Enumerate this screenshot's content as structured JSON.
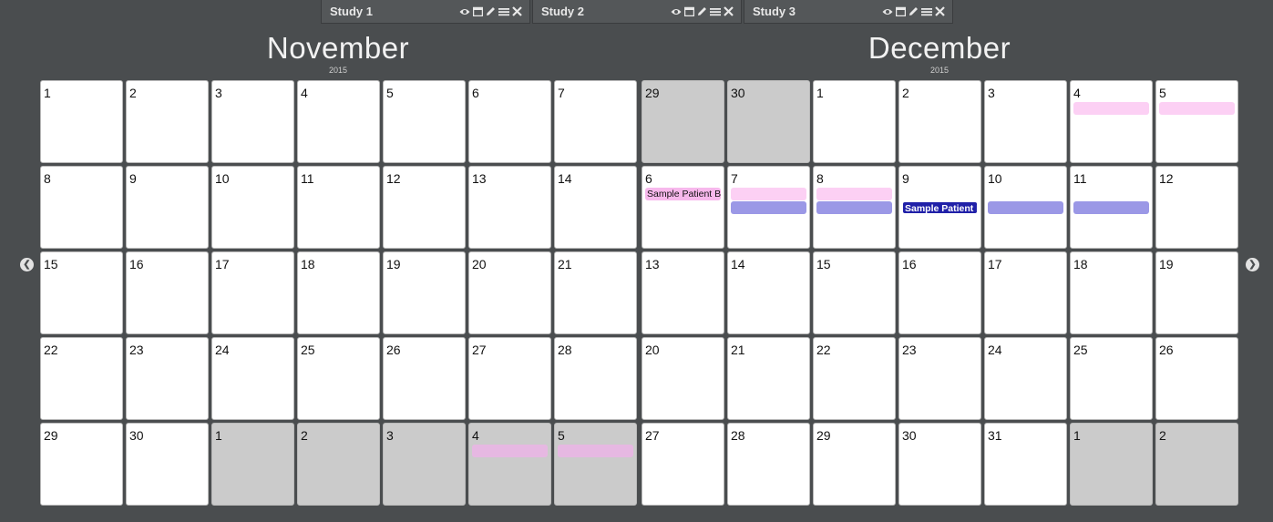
{
  "studies": [
    {
      "label": "Study 1"
    },
    {
      "label": "Study 2"
    },
    {
      "label": "Study 3"
    }
  ],
  "tab_icons": [
    "eye-icon",
    "calendar-icon",
    "pencil-icon",
    "menu-icon",
    "close-icon"
  ],
  "navigation": {
    "prev_icon": "chevron-left-icon",
    "next_icon": "chevron-right-icon"
  },
  "months": [
    {
      "name": "November",
      "year": "2015",
      "days": [
        {
          "n": "1",
          "other": false
        },
        {
          "n": "2",
          "other": false
        },
        {
          "n": "3",
          "other": false
        },
        {
          "n": "4",
          "other": false
        },
        {
          "n": "5",
          "other": false
        },
        {
          "n": "6",
          "other": false
        },
        {
          "n": "7",
          "other": false
        },
        {
          "n": "8",
          "other": false
        },
        {
          "n": "9",
          "other": false
        },
        {
          "n": "10",
          "other": false
        },
        {
          "n": "11",
          "other": false
        },
        {
          "n": "12",
          "other": false
        },
        {
          "n": "13",
          "other": false
        },
        {
          "n": "14",
          "other": false
        },
        {
          "n": "15",
          "other": false
        },
        {
          "n": "16",
          "other": false
        },
        {
          "n": "17",
          "other": false
        },
        {
          "n": "18",
          "other": false
        },
        {
          "n": "19",
          "other": false
        },
        {
          "n": "20",
          "other": false
        },
        {
          "n": "21",
          "other": false
        },
        {
          "n": "22",
          "other": false
        },
        {
          "n": "23",
          "other": false
        },
        {
          "n": "24",
          "other": false
        },
        {
          "n": "25",
          "other": false
        },
        {
          "n": "26",
          "other": false
        },
        {
          "n": "27",
          "other": false
        },
        {
          "n": "28",
          "other": false
        },
        {
          "n": "29",
          "other": false
        },
        {
          "n": "30",
          "other": false
        },
        {
          "n": "1",
          "other": true
        },
        {
          "n": "2",
          "other": true
        },
        {
          "n": "3",
          "other": true
        },
        {
          "n": "4",
          "other": true,
          "events": [
            {
              "style": "mauve",
              "label": ""
            }
          ]
        },
        {
          "n": "5",
          "other": true,
          "events": [
            {
              "style": "mauve",
              "label": ""
            }
          ]
        }
      ]
    },
    {
      "name": "December",
      "year": "2015",
      "days": [
        {
          "n": "29",
          "other": true
        },
        {
          "n": "30",
          "other": true
        },
        {
          "n": "1",
          "other": false
        },
        {
          "n": "2",
          "other": false
        },
        {
          "n": "3",
          "other": false
        },
        {
          "n": "4",
          "other": false,
          "events": [
            {
              "style": "light",
              "label": ""
            }
          ]
        },
        {
          "n": "5",
          "other": false,
          "events": [
            {
              "style": "light",
              "label": ""
            }
          ]
        },
        {
          "n": "6",
          "other": false,
          "events": [
            {
              "style": "pink",
              "label": "Sample Patient B"
            }
          ]
        },
        {
          "n": "7",
          "other": false,
          "events": [
            {
              "style": "light",
              "label": ""
            },
            {
              "style": "purple",
              "label": ""
            }
          ]
        },
        {
          "n": "8",
          "other": false,
          "events": [
            {
              "style": "light",
              "label": ""
            },
            {
              "style": "purple",
              "label": ""
            }
          ]
        },
        {
          "n": "9",
          "other": false,
          "events": [
            {
              "style": "dark",
              "label": "Sample Patient F",
              "slot": 1
            }
          ]
        },
        {
          "n": "10",
          "other": false,
          "events": [
            {
              "style": "purple",
              "label": "",
              "slot": 1
            }
          ]
        },
        {
          "n": "11",
          "other": false,
          "events": [
            {
              "style": "purple",
              "label": "",
              "slot": 1
            }
          ]
        },
        {
          "n": "12",
          "other": false
        },
        {
          "n": "13",
          "other": false
        },
        {
          "n": "14",
          "other": false
        },
        {
          "n": "15",
          "other": false
        },
        {
          "n": "16",
          "other": false
        },
        {
          "n": "17",
          "other": false
        },
        {
          "n": "18",
          "other": false
        },
        {
          "n": "19",
          "other": false
        },
        {
          "n": "20",
          "other": false
        },
        {
          "n": "21",
          "other": false
        },
        {
          "n": "22",
          "other": false
        },
        {
          "n": "23",
          "other": false
        },
        {
          "n": "24",
          "other": false
        },
        {
          "n": "25",
          "other": false
        },
        {
          "n": "26",
          "other": false
        },
        {
          "n": "27",
          "other": false
        },
        {
          "n": "28",
          "other": false
        },
        {
          "n": "29",
          "other": false
        },
        {
          "n": "30",
          "other": false
        },
        {
          "n": "31",
          "other": false
        },
        {
          "n": "1",
          "other": true
        },
        {
          "n": "2",
          "other": true
        }
      ]
    }
  ],
  "colors": {
    "background": "#4a4d4f",
    "outside_month_day": "#cbcbcb",
    "event_light_pink": "#fcd0f4",
    "event_pink": "#f7b8ec",
    "event_purple": "#9b98e6",
    "event_dark_blue": "#2020a8",
    "event_mauve": "#e6b8e2"
  }
}
